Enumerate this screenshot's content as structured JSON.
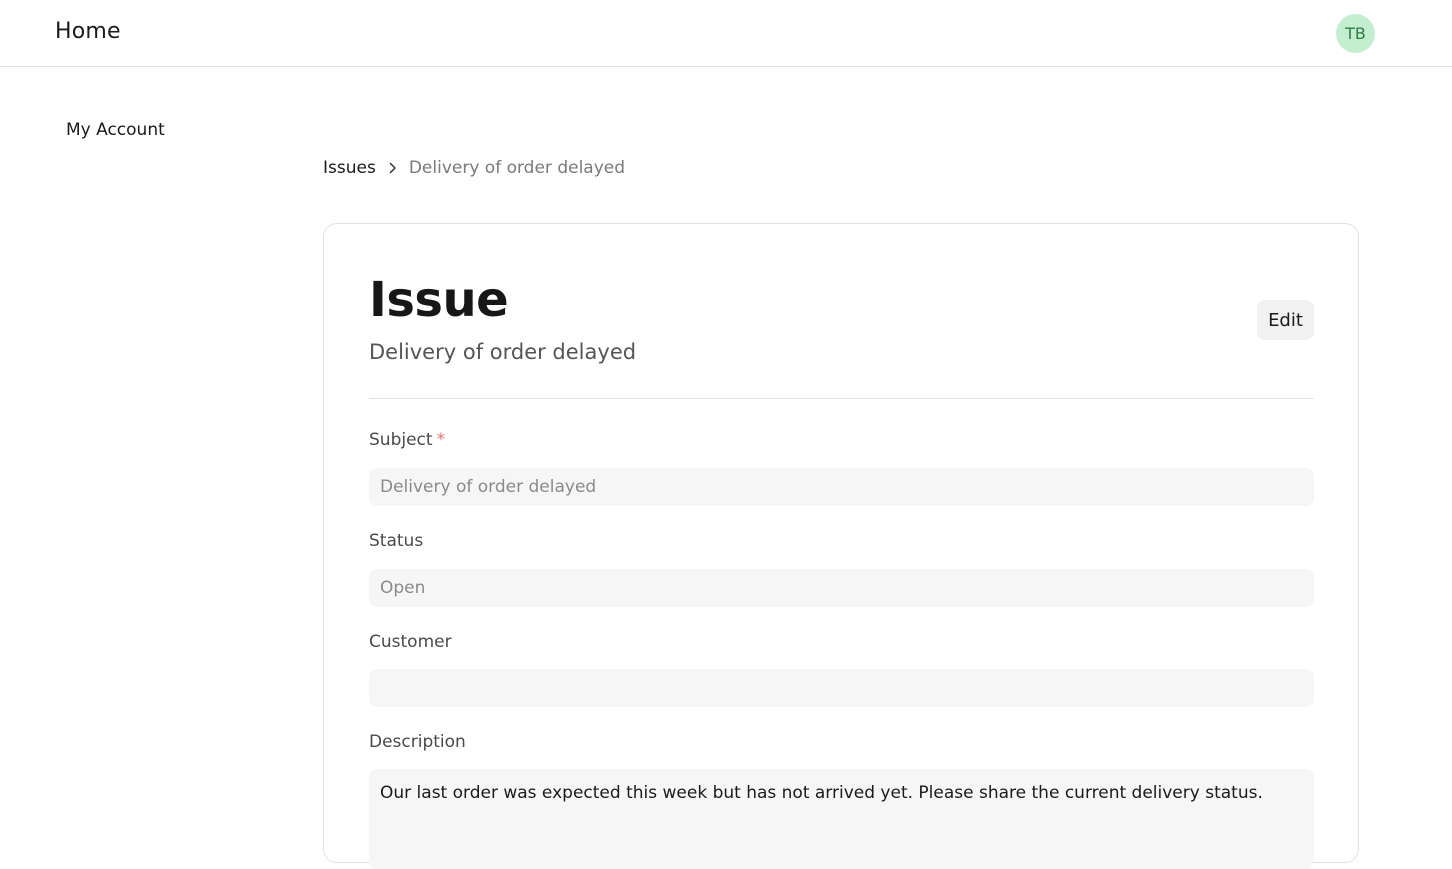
{
  "header": {
    "home_label": "Home",
    "avatar_initials": "TB"
  },
  "sidebar": {
    "items": [
      {
        "label": "My Account"
      }
    ]
  },
  "breadcrumb": {
    "parent": "Issues",
    "current": "Delivery of order delayed"
  },
  "card": {
    "title": "Issue",
    "subtitle": "Delivery of order delayed",
    "edit_label": "Edit"
  },
  "form": {
    "subject": {
      "label": "Subject",
      "required_marker": "*",
      "value": "Delivery of order delayed"
    },
    "status": {
      "label": "Status",
      "value": "Open"
    },
    "customer": {
      "label": "Customer",
      "value": ""
    },
    "description": {
      "label": "Description",
      "value": "Our last order was expected this week but has not arrived yet. Please share the current delivery status."
    }
  },
  "colors": {
    "avatar_bg": "#c3efd0",
    "avatar_text": "#2e7d45",
    "required_star": "#e57373"
  },
  "icons": {
    "breadcrumb_separator": "chevron-right-icon"
  }
}
